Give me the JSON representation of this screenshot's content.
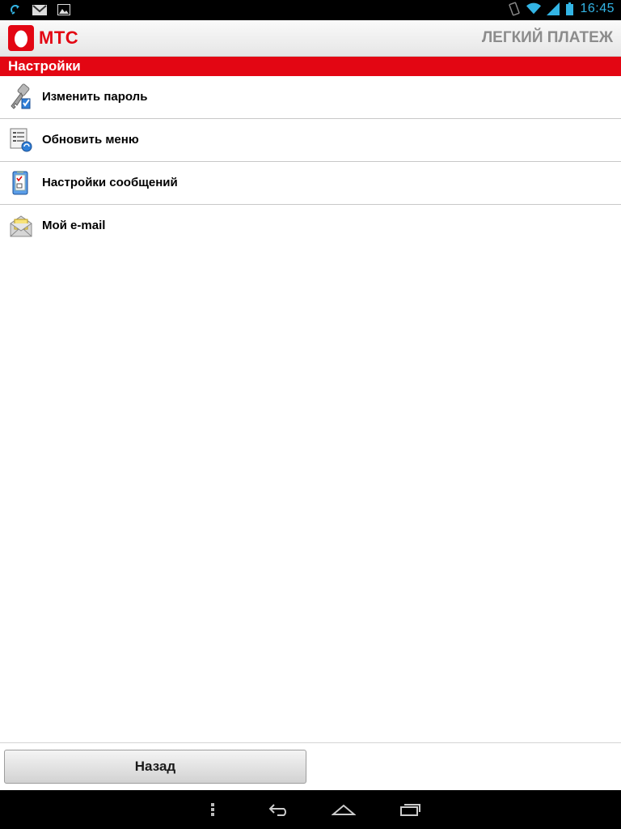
{
  "status_bar": {
    "time": "16:45",
    "left_icons": [
      "sync-icon",
      "gmail-icon",
      "gallery-icon"
    ],
    "right_icons": [
      "rotation-lock-icon",
      "wifi-icon",
      "signal-icon",
      "battery-icon"
    ],
    "clock_color": "#33b5e5"
  },
  "header": {
    "logo_text": "МТС",
    "app_title": "ЛЕГКИЙ ПЛАТЕЖ",
    "brand_color": "#e30613"
  },
  "section": {
    "title": "Настройки"
  },
  "menu": [
    {
      "label": "Изменить пароль",
      "icon": "key-icon"
    },
    {
      "label": "Обновить меню",
      "icon": "update-menu-icon"
    },
    {
      "label": "Настройки сообщений",
      "icon": "message-settings-icon"
    },
    {
      "label": "Мой e-mail",
      "icon": "email-icon"
    }
  ],
  "footer": {
    "back_label": "Назад"
  },
  "nav_bar": {
    "buttons": [
      "menu-icon",
      "back-icon",
      "home-icon",
      "recent-apps-icon"
    ]
  }
}
